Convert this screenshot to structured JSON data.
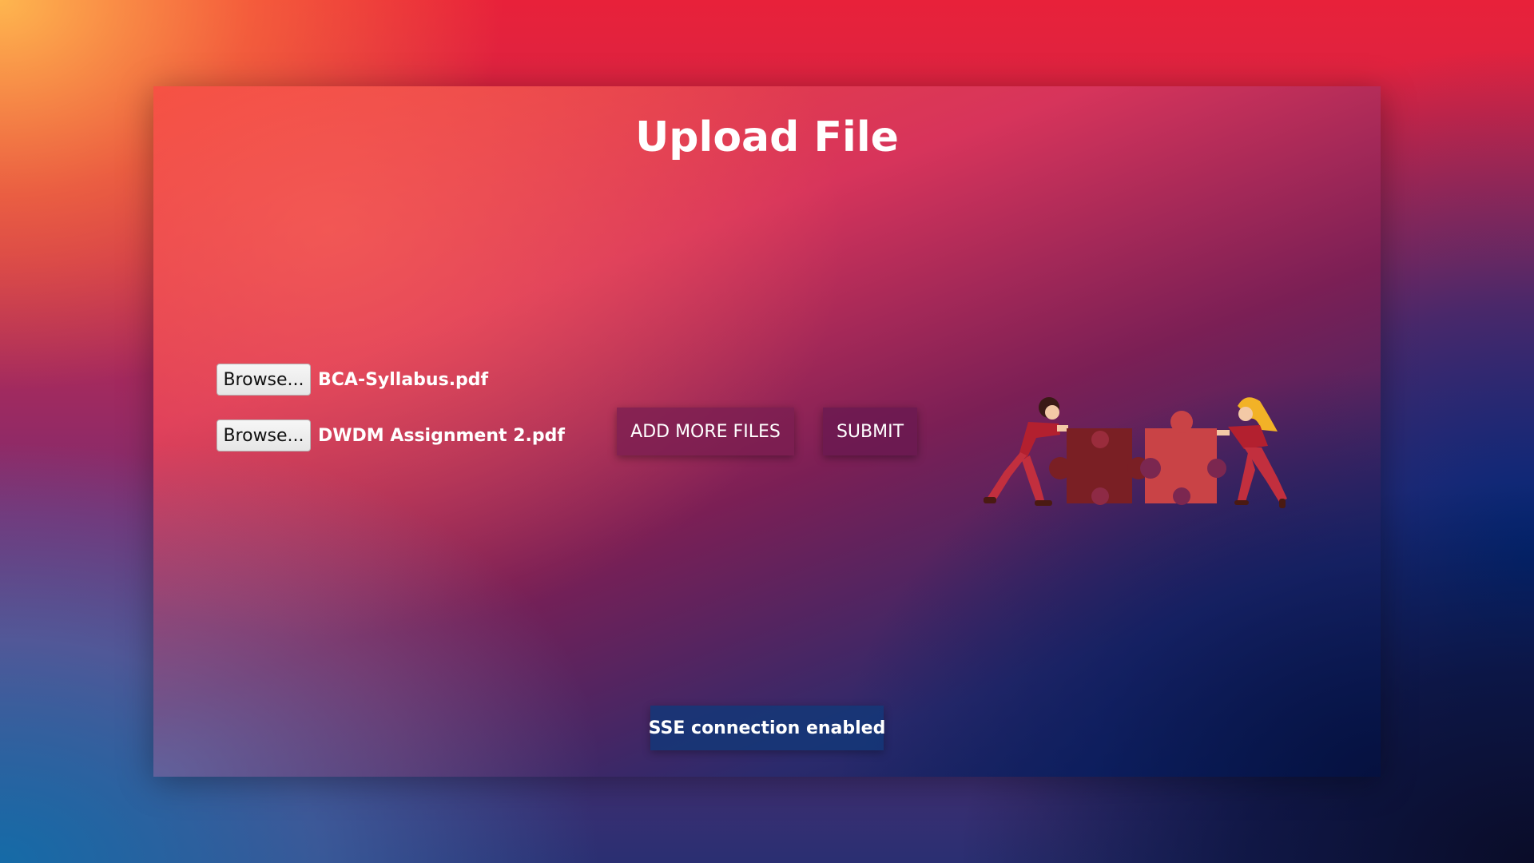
{
  "page": {
    "title": "Upload File"
  },
  "files": [
    {
      "browse_label": "Browse...",
      "file_name": "BCA-Syllabus.pdf"
    },
    {
      "browse_label": "Browse...",
      "file_name": "DWDM Assignment 2.pdf"
    }
  ],
  "actions": {
    "add_more_label": "ADD MORE FILES",
    "submit_label": "SUBMIT"
  },
  "status": {
    "text": "SSE connection enabled"
  },
  "illustration": {
    "icon": "teamwork-puzzle-illustration",
    "colors": {
      "dark_piece": "#7a1f24",
      "light_piece": "#c94346",
      "shirt": "#b3202f",
      "pants": "#c22f3e",
      "hair_woman": "#f2b227",
      "hair_man": "#3a1a16"
    }
  }
}
